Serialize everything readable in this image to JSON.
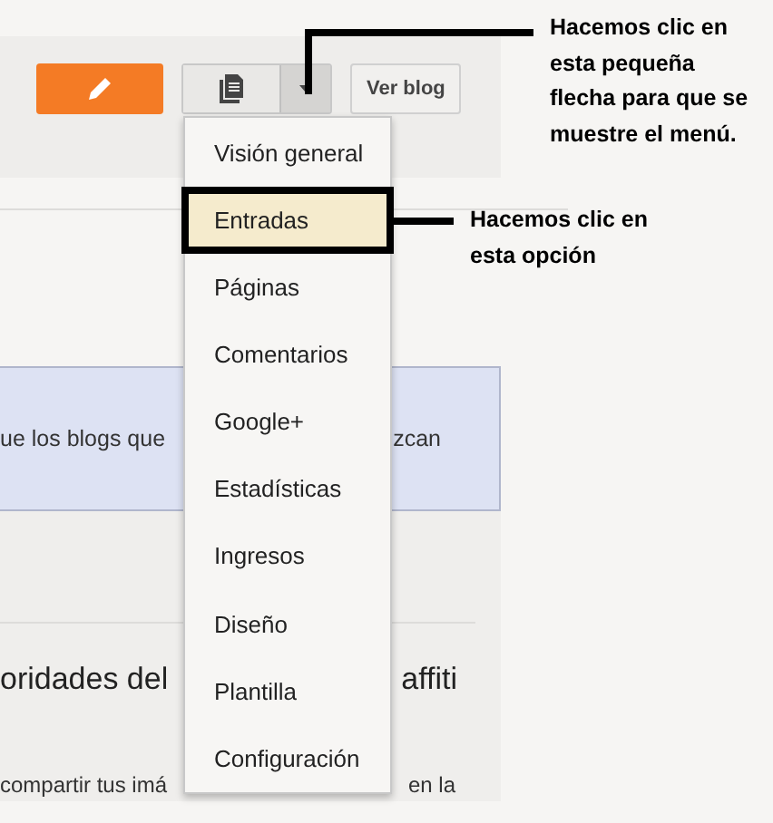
{
  "toolbar": {
    "view_blog_button": "Ver blog"
  },
  "menu": {
    "items": [
      {
        "label": "Visión general",
        "selected": false
      },
      {
        "label": "Entradas",
        "selected": true
      },
      {
        "label": "Páginas",
        "selected": false
      },
      {
        "label": "Comentarios",
        "selected": false
      },
      {
        "label": "Google+",
        "selected": false
      },
      {
        "label": "Estadísticas",
        "selected": false
      },
      {
        "label": "Ingresos",
        "selected": false
      },
      {
        "label": "Diseño",
        "selected": false
      },
      {
        "label": "Plantilla",
        "selected": false
      },
      {
        "label": "Configuración",
        "selected": false
      }
    ]
  },
  "notice": {
    "text_left": "ue los blogs que",
    "text_right": "zcan"
  },
  "post": {
    "title_left": "oridades del",
    "title_right": "affiti",
    "snippet_left": "compartir tus imá",
    "snippet_right": "en la"
  },
  "annotations": [
    {
      "lines": [
        "Hacemos clic en",
        "esta pequeña",
        "flecha para que se",
        "muestre el menú."
      ]
    },
    {
      "lines": [
        "Hacemos clic en",
        "esta opción"
      ]
    }
  ]
}
